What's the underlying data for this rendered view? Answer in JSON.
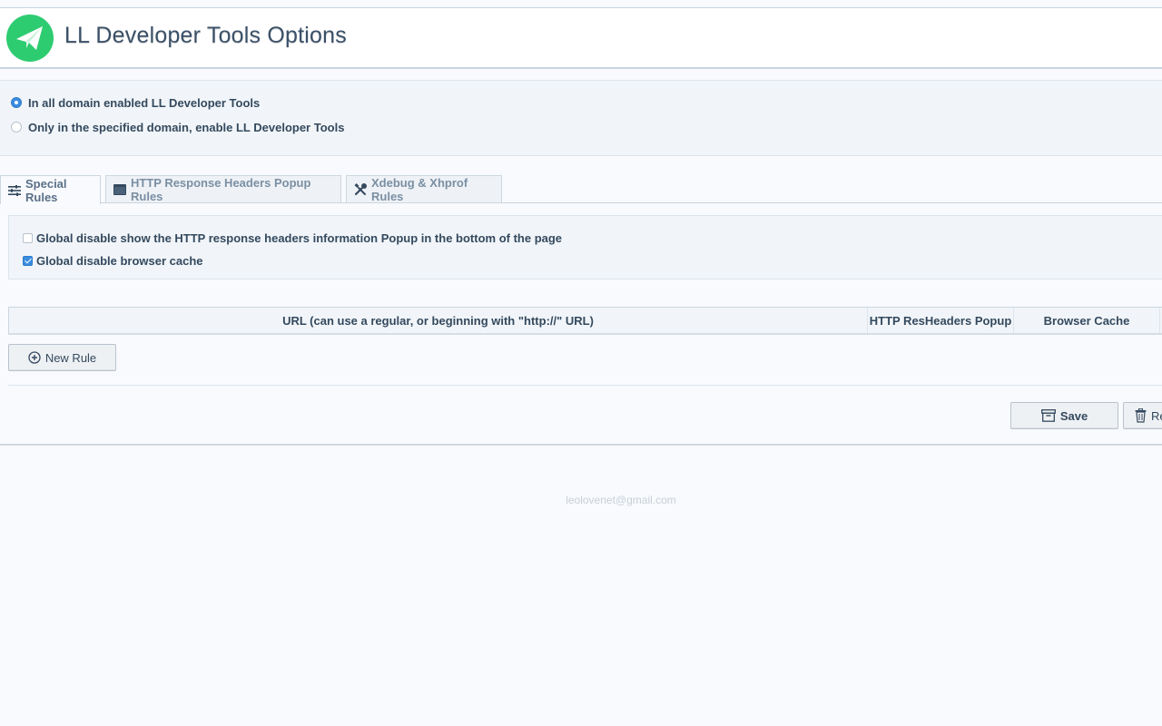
{
  "header": {
    "title": "LL Developer Tools Options",
    "logo_icon": "paper-plane-icon",
    "logo_color": "#2ecc71"
  },
  "mode": {
    "options": [
      {
        "label": "In all domain enabled LL Developer Tools",
        "selected": true
      },
      {
        "label": "Only in the specified domain, enable LL Developer Tools",
        "selected": false
      }
    ]
  },
  "tabs": [
    {
      "label": "Special Rules",
      "icon": "sliders-icon",
      "active": true
    },
    {
      "label": "HTTP Response Headers Popup Rules",
      "icon": "window-icon",
      "active": false
    },
    {
      "label": "Xdebug & Xhprof Rules",
      "icon": "tools-icon",
      "active": false
    }
  ],
  "special_rules": {
    "checks": [
      {
        "label": "Global disable show the HTTP response headers information Popup in the bottom of the page",
        "checked": false
      },
      {
        "label": "Global disable browser cache",
        "checked": true
      }
    ]
  },
  "table": {
    "columns": [
      "URL (can use a regular, or beginning with \"http://\" URL)",
      "HTTP ResHeaders Popup",
      "Browser Cache"
    ]
  },
  "buttons": {
    "new_rule": "New Rule",
    "save": "Save",
    "reset": "Re"
  },
  "footer": {
    "email": "leolovenet@gmail.com"
  },
  "colors": {
    "accent": "#3a8de0",
    "brand": "#2ecc71"
  }
}
